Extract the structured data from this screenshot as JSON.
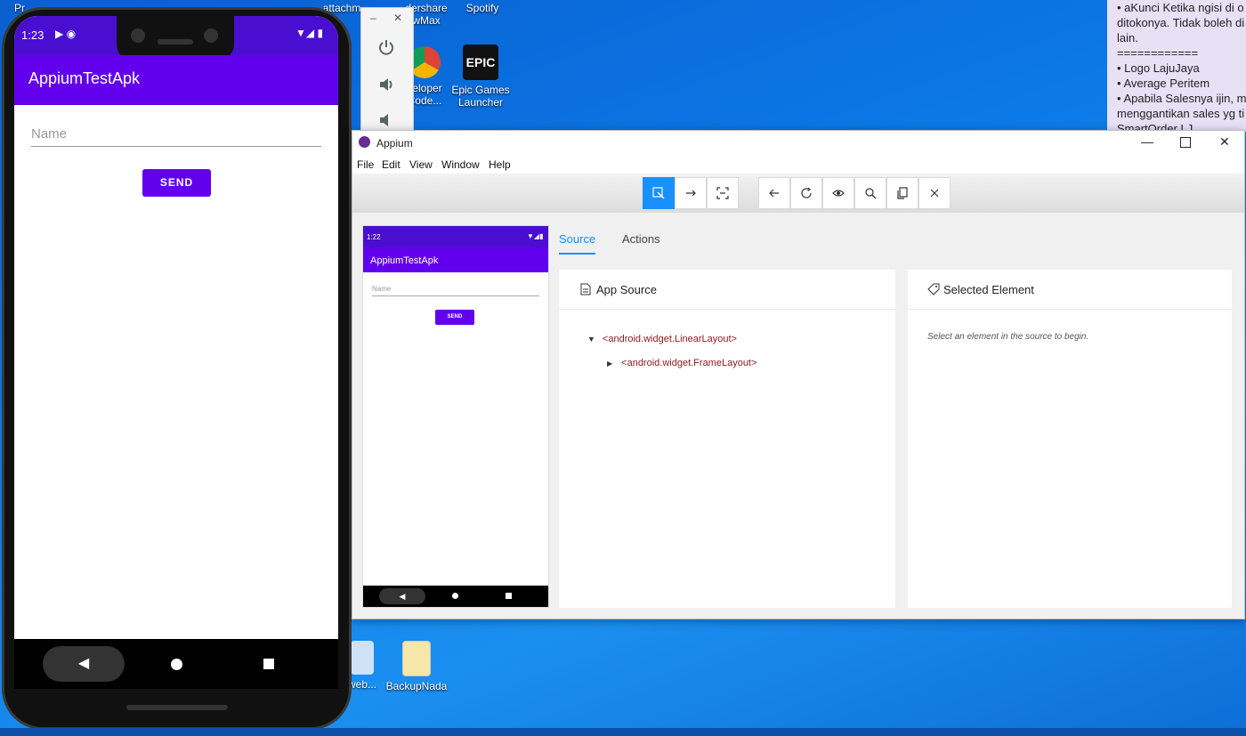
{
  "desktop": {
    "top_labels": [
      "Pr",
      "attachm",
      "dershare wMax",
      "Spotify"
    ],
    "icons": [
      {
        "label": "Epic Games Launcher",
        "icon": "epic-games-icon"
      },
      {
        "label": "veloper Code...",
        "icon": "chrome-icon"
      },
      {
        "label": "BackupNada",
        "icon": "file-icon"
      },
      {
        "label": "web...",
        "icon": "notepad-icon"
      }
    ],
    "sticky_note": "• aKunci Ketika ngisi di o\nditokonya. Tidak boleh di\nlain.\n============\n• Logo LajuJaya\n• Average Peritem\n• Apabila Salesnya ijin, m\nmenggantikan sales yg ti\nSmartOrder LJ"
  },
  "phone": {
    "time": "1:23",
    "app_title": "AppiumTestApk",
    "name_placeholder": "Name",
    "send_label": "SEND"
  },
  "appium": {
    "title": "Appium",
    "menu": [
      "File",
      "Edit",
      "View",
      "Window",
      "Help"
    ],
    "toolbar_group1": [
      "select-elements-icon",
      "swipe-icon",
      "tap-icon"
    ],
    "toolbar_group2": [
      "back-icon",
      "refresh-icon",
      "eye-icon",
      "search-icon",
      "copy-icon",
      "close-icon"
    ],
    "mini_phone": {
      "time": "1:22",
      "app_title": "AppiumTestApk",
      "name_placeholder": "Name",
      "send_label": "SEND"
    },
    "tabs": {
      "source": "Source",
      "actions": "Actions"
    },
    "app_source": {
      "header": "App Source",
      "nodes": [
        "<android.widget.LinearLayout>",
        "<android.widget.FrameLayout>"
      ]
    },
    "selected_element": {
      "header": "Selected Element",
      "hint": "Select an element in the source to begin."
    }
  },
  "colors": {
    "accent": "#6200ee",
    "status": "#4a0ed1",
    "appium_blue": "#1890ff",
    "tree_text": "#8b1a1a"
  }
}
